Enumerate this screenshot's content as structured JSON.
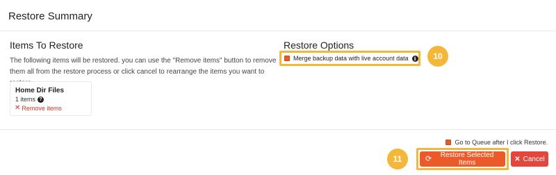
{
  "header": {
    "title": "Restore Summary"
  },
  "items_section": {
    "title": "Items To Restore",
    "description": "The following items will be restored. you can use the \"Remove items\" button to remove them all from the restore process or click cancel to rearrange the items you want to restore",
    "card": {
      "title": "Home Dir Files",
      "count": "1 items",
      "help_icon": "?",
      "remove_icon": "✕",
      "remove_label": "Remove items"
    }
  },
  "options_section": {
    "title": "Restore Options",
    "merge_label": "Merge backup data with live account data",
    "merge_checked": true,
    "info_icon": "i"
  },
  "annotations": {
    "step_a": "10",
    "step_b": "11"
  },
  "footer": {
    "queue_label": "Go to Queue after I click Restore.",
    "queue_checked": true,
    "restore_label": "Restore Selected Items",
    "cancel_label": "Cancel"
  },
  "colors": {
    "accent": "#ed5a2a",
    "cancel": "#e2463d",
    "highlight": "#f3b83a",
    "danger_link": "#d0342c"
  }
}
